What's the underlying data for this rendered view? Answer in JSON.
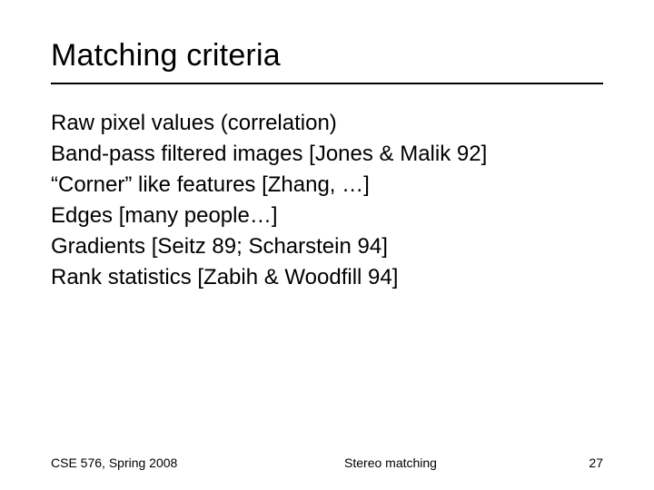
{
  "title": "Matching criteria",
  "items": [
    "Raw pixel values (correlation)",
    "Band-pass filtered images [Jones & Malik 92]",
    "“Corner” like features [Zhang, …]",
    "Edges [many people…]",
    "Gradients [Seitz 89;  Scharstein 94]",
    "Rank statistics [Zabih & Woodfill 94]"
  ],
  "footer": {
    "left": "CSE 576, Spring 2008",
    "center": "Stereo matching",
    "page": "27"
  }
}
